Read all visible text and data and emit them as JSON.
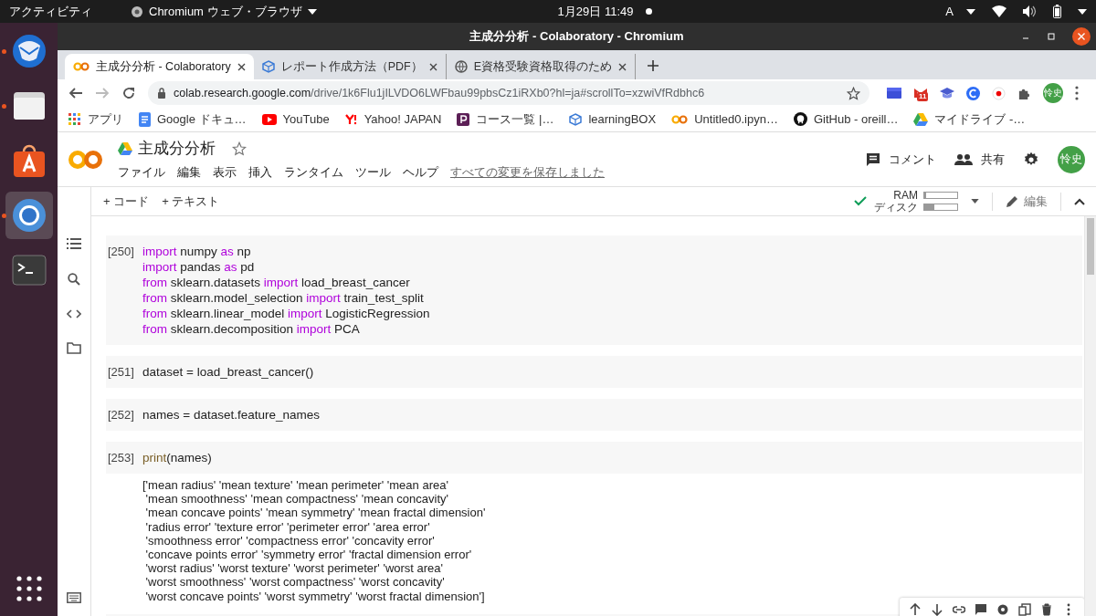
{
  "system_bar": {
    "activities": "アクティビティ",
    "app_menu": "Chromium ウェブ・ブラウザ",
    "clock": "1月29日  11:49",
    "input_method": "A"
  },
  "dock": [
    {
      "running": true,
      "selected": false
    },
    {
      "running": true,
      "selected": false
    },
    {
      "running": false,
      "selected": false
    },
    {
      "running": true,
      "selected": true
    },
    {
      "running": false,
      "selected": false
    }
  ],
  "window": {
    "title": "主成分分析 - Colaboratory - Chromium"
  },
  "tabs": [
    {
      "label": "主成分分析 - Colaboratory",
      "selected": true
    },
    {
      "label": "レポート作成方法（PDF）",
      "selected": false
    },
    {
      "label": "E資格受験資格取得のため",
      "selected": false
    }
  ],
  "address_bar": {
    "host": "colab.research.google.com",
    "path": "/drive/1k6Flu1jILVDO6LWFbau99pbsCz1iRXb0?hl=ja#scrollTo=xzwiVfRdbhc6",
    "mail_badge": "11",
    "profile": "怜史"
  },
  "bookmarks": [
    {
      "label": "アプリ"
    },
    {
      "label": "Google ドキュ…"
    },
    {
      "label": "YouTube"
    },
    {
      "label": "Yahoo! JAPAN"
    },
    {
      "label": "コース一覧 |…"
    },
    {
      "label": "learningBOX"
    },
    {
      "label": "Untitled0.ipyn…"
    },
    {
      "label": "GitHub - oreill…"
    },
    {
      "label": "マイドライブ -…"
    }
  ],
  "notebook": {
    "title": "主成分分析",
    "starred": false,
    "menus": [
      "ファイル",
      "編集",
      "表示",
      "挿入",
      "ランタイム",
      "ツール",
      "ヘルプ"
    ],
    "save_status": "すべての変更を保存しました",
    "comment": "コメント",
    "share": "共有",
    "avatar": "怜史"
  },
  "toolbar": {
    "add_code": "+ コード",
    "add_text": "+ テキスト",
    "connected": true,
    "ram": {
      "label": "RAM",
      "level": 0.05
    },
    "disk": {
      "label": "ディスク",
      "level": 0.3
    },
    "edit": "編集"
  },
  "cells": [
    {
      "prompt": "[250]",
      "lines": [
        [
          {
            "t": "import",
            "kind": "keyword"
          },
          {
            "t": " numpy ",
            "kind": "plain"
          },
          {
            "t": "as",
            "kind": "keyword"
          },
          {
            "t": " np",
            "kind": "plain"
          }
        ],
        [
          {
            "t": "import",
            "kind": "keyword"
          },
          {
            "t": " pandas ",
            "kind": "plain"
          },
          {
            "t": "as",
            "kind": "keyword"
          },
          {
            "t": " pd",
            "kind": "plain"
          }
        ],
        [
          {
            "t": "from",
            "kind": "keyword"
          },
          {
            "t": " sklearn.datasets ",
            "kind": "plain"
          },
          {
            "t": "import",
            "kind": "keyword"
          },
          {
            "t": " load_breast_cancer",
            "kind": "plain"
          }
        ],
        [
          {
            "t": "from",
            "kind": "keyword"
          },
          {
            "t": " sklearn.model_selection ",
            "kind": "plain"
          },
          {
            "t": "import",
            "kind": "keyword"
          },
          {
            "t": " train_test_split",
            "kind": "plain"
          }
        ],
        [
          {
            "t": "from",
            "kind": "keyword"
          },
          {
            "t": " sklearn.linear_model ",
            "kind": "plain"
          },
          {
            "t": "import",
            "kind": "keyword"
          },
          {
            "t": " LogisticRegression",
            "kind": "plain"
          }
        ],
        [
          {
            "t": "from",
            "kind": "keyword"
          },
          {
            "t": " sklearn.decomposition ",
            "kind": "plain"
          },
          {
            "t": "import",
            "kind": "keyword"
          },
          {
            "t": " PCA",
            "kind": "plain"
          }
        ]
      ]
    },
    {
      "prompt": "[251]",
      "lines": [
        [
          {
            "t": "dataset = load_breast_cancer()",
            "kind": "plain"
          }
        ]
      ]
    },
    {
      "prompt": "[252]",
      "lines": [
        [
          {
            "t": "names = dataset.feature_names",
            "kind": "plain"
          }
        ]
      ]
    },
    {
      "prompt": "[253]",
      "lines": [
        [
          {
            "t": "print",
            "kind": "builtin"
          },
          {
            "t": "(names)",
            "kind": "plain"
          }
        ]
      ],
      "output": [
        "['mean radius' 'mean texture' 'mean perimeter' 'mean area'",
        " 'mean smoothness' 'mean compactness' 'mean concavity'",
        " 'mean concave points' 'mean symmetry' 'mean fractal dimension'",
        " 'radius error' 'texture error' 'perimeter error' 'area error'",
        " 'smoothness error' 'compactness error' 'concavity error'",
        " 'concave points error' 'symmetry error' 'fractal dimension error'",
        " 'worst radius' 'worst texture' 'worst perimeter' 'worst area'",
        " 'worst smoothness' 'worst compactness' 'worst concavity'",
        " 'worst concave points' 'worst symmetry' 'worst fractal dimension']"
      ]
    }
  ]
}
